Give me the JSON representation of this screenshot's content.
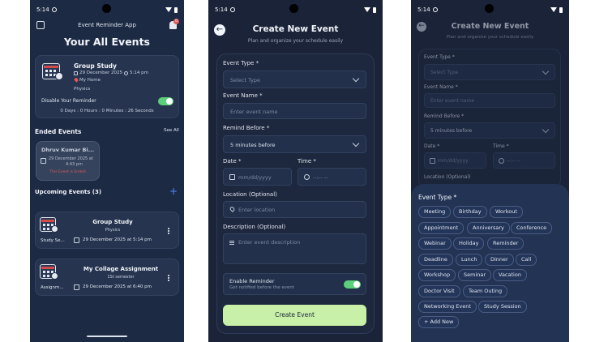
{
  "status_time": "5:14",
  "home": {
    "app_title": "Event Reminder App",
    "notification_count": "0",
    "heading": "Your All Events",
    "featured": {
      "title": "Group Study",
      "date": "29 December 2025",
      "time": "5:14 pm",
      "location": "My Home",
      "category": "Physics",
      "reminder_label": "Disable Your Reminder",
      "countdown": "0 Days : 0 Hours : 0 Minutes : 26 Seconds"
    },
    "ended_label": "Ended Events",
    "see_all": "See All",
    "ended_event": {
      "name": "Dhruv Kumar Bi...",
      "date": "29 December 2025 at",
      "time": "4:43 pm",
      "status": "This Event is Ended"
    },
    "upcoming_label": "Upcoming Events (3)",
    "add_symbol": "+",
    "upcoming": [
      {
        "title": "Group Study",
        "category": "Physics",
        "side_label": "Study Se...",
        "datetime": "29 December 2025 at 5:14 pm"
      },
      {
        "title": "My Collage Assignment",
        "category": "1St semester",
        "side_label": "Assignm...",
        "datetime": "29 December 2025 at 6:40 pm"
      }
    ]
  },
  "create": {
    "title": "Create New Event",
    "subtitle": "Plan and organize your schedule easily",
    "event_type_label": "Event Type *",
    "event_type_placeholder": "Select Type",
    "event_name_label": "Event Name *",
    "event_name_placeholder": "Enter event name",
    "remind_label": "Remind Before *",
    "remind_value": "5 minutes before",
    "date_label": "Date *",
    "date_placeholder": "mm/dd/yyyy",
    "time_label": "Time *",
    "time_placeholder": "--:-- --",
    "location_label": "Location (Optional)",
    "location_placeholder": "Enter location",
    "description_label": "Description (Optional)",
    "description_placeholder": "Enter event description",
    "reminder_title": "Enable Reminder",
    "reminder_sub": "Get notified before the event",
    "submit": "Create Event"
  },
  "type_sheet": {
    "title": "Event Type *",
    "chips": [
      "Meeting",
      "Birthday",
      "Workout",
      "Appointment",
      "Anniversary",
      "Conference",
      "Webinar",
      "Holiday",
      "Reminder",
      "Deadline",
      "Lunch",
      "Dinner",
      "Call",
      "Workshop",
      "Seminar",
      "Vacation",
      "Doctor Visit",
      "Team Outing",
      "Networking Event",
      "Study Session"
    ],
    "add_new": "+ Add New"
  },
  "colors": {
    "accent_green": "#5bd07a",
    "button_green": "#c9f0a8",
    "ended_red": "#e25a5a",
    "add_blue": "#4a8cff"
  }
}
